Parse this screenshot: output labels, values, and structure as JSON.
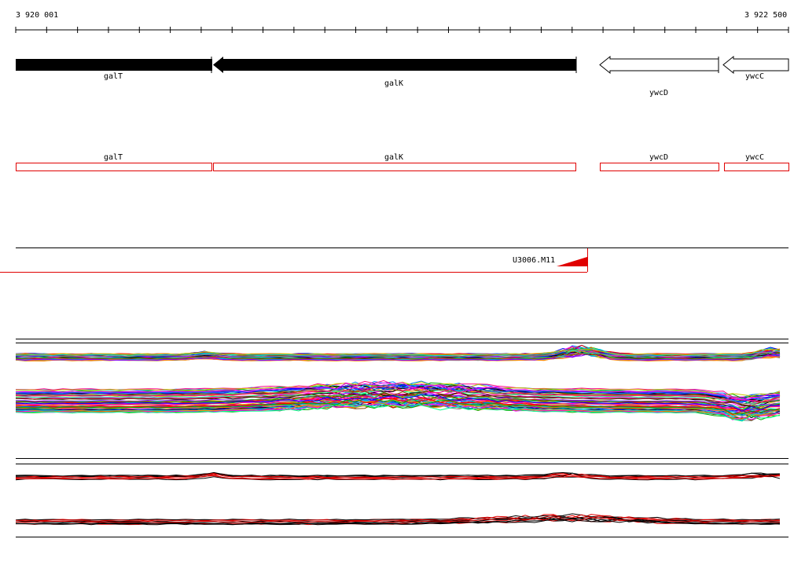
{
  "ruler": {
    "start_label": "3 920 001",
    "end_label": "3 922 500"
  },
  "genes_track": [
    {
      "name": "galT",
      "strand": "-",
      "style": "filled"
    },
    {
      "name": "galK",
      "strand": "-",
      "style": "filled"
    },
    {
      "name": "ywcD",
      "strand": "-",
      "style": "outline"
    },
    {
      "name": "ywcC",
      "strand": "-",
      "style": "outline"
    }
  ],
  "cds_track": [
    {
      "name": "galT"
    },
    {
      "name": "galK"
    },
    {
      "name": "ywcD"
    },
    {
      "name": "ywcC"
    }
  ],
  "probe_track": {
    "label": "U3006.M11",
    "color": "#e00000"
  },
  "profile_colors": [
    "#ff0000",
    "#00aa00",
    "#0000ff",
    "#ff00ff",
    "#00cccc",
    "#cccc00",
    "#000000",
    "#ff8800",
    "#8800ff",
    "#888888",
    "#00ff88",
    "#884400",
    "#0088ff",
    "#ff0088"
  ],
  "colors": {
    "accent": "#e00000",
    "line": "#000000",
    "background": "#ffffff"
  }
}
